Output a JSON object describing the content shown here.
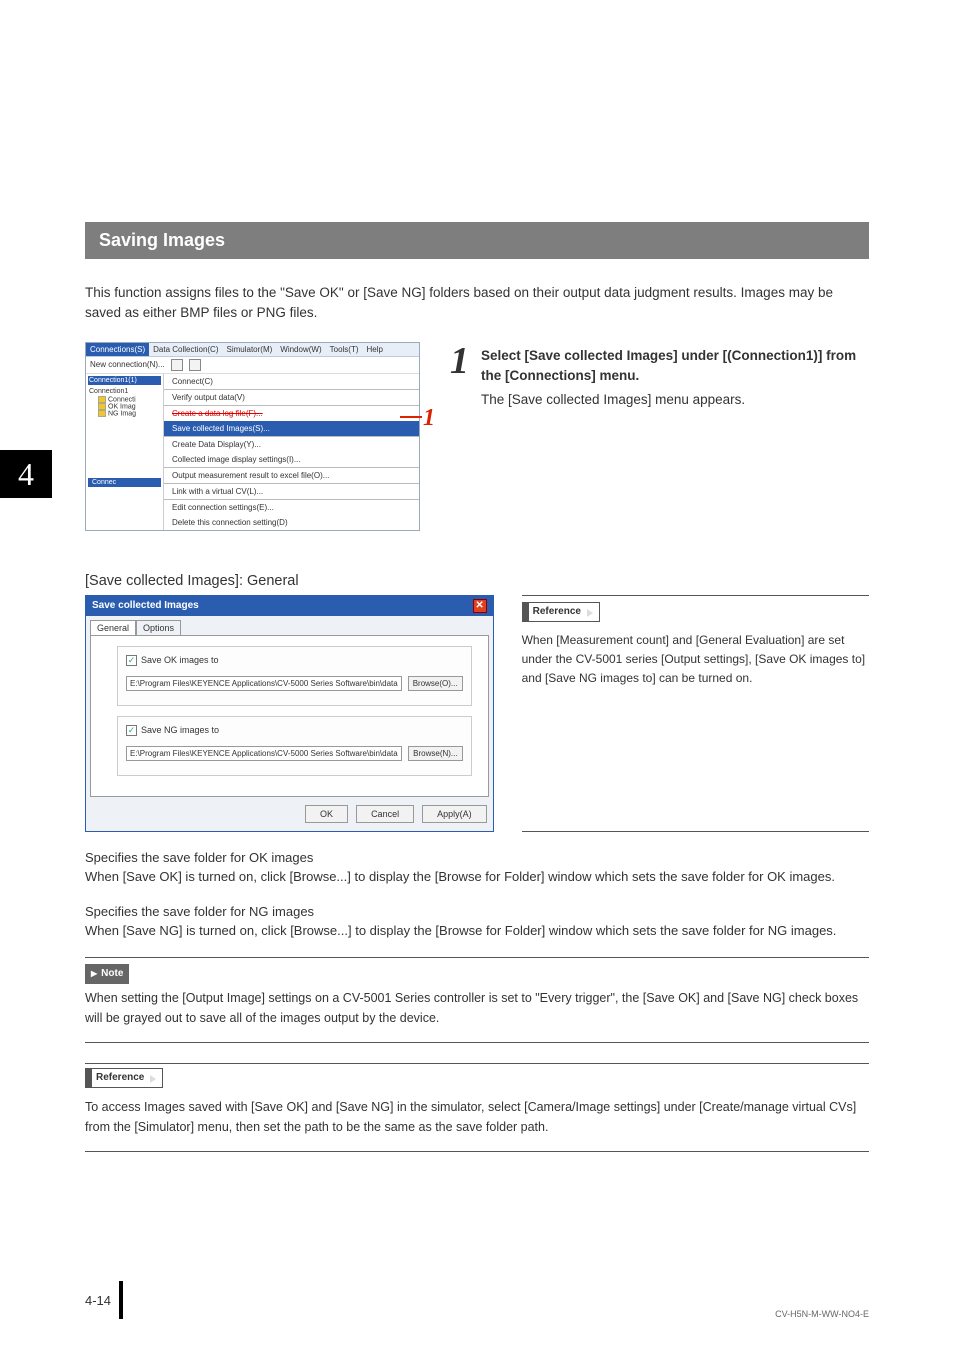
{
  "chapter_number": "4",
  "section_header": "Saving Images",
  "intro": "This function assigns files to the \"Save OK\" or [Save NG] folders based on their output data judgment results. Images may be saved as either BMP files or PNG files.",
  "step1": {
    "num": "1",
    "title": "Select [Save collected Images] under [(Connection1)] from the [Connections] menu.",
    "desc": "The [Save collected Images] menu appears."
  },
  "menu_shot": {
    "menubar": [
      "Connections(S)",
      "Data Collection(C)",
      "Simulator(M)",
      "Window(W)",
      "Tools(T)",
      "Help"
    ],
    "new_conn": "New connection(N)...",
    "conn1": "Connection1(1)",
    "tree_root": "Connection1",
    "tree_items": [
      "Connecti",
      "OK Imag",
      "NG Imag"
    ],
    "status": "Connec",
    "submenu": [
      "Connect(C)",
      "Verify output data(V)",
      "Create a data log file(F)...",
      "Save collected Images(S)...",
      "Create Data Display(Y)...",
      "Collected image display settings(I)...",
      "Output measurement result to excel file(O)...",
      "Link with a virtual CV(L)...",
      "Edit connection settings(E)...",
      "Delete this connection setting(D)"
    ],
    "callout": "1"
  },
  "sub_heading": "[Save collected Images]: General",
  "dialog": {
    "title": "Save collected Images",
    "tabs": [
      "General",
      "Options"
    ],
    "save_ok_label": "Save OK images to",
    "save_ng_label": "Save NG images to",
    "path": "E:\\Program Files\\KEYENCE Applications\\CV-5000 Series Software\\bin\\data",
    "browse_o": "Browse(O)...",
    "browse_n": "Browse(N)...",
    "ok": "OK",
    "cancel": "Cancel",
    "apply": "Apply(A)"
  },
  "ref_label": "Reference",
  "ref1_text": "When [Measurement count] and [General Evaluation] are set under the CV-5001 series [Output settings], [Save OK images to] and [Save NG images to] can be turned on.",
  "ok_spec_title": "Specifies the save folder for OK images",
  "ok_spec_text": "When [Save OK] is turned on, click [Browse...] to display the [Browse for Folder] window which sets the save folder for OK images.",
  "ng_spec_title": "Specifies the save folder for NG images",
  "ng_spec_text": "When [Save NG] is turned on, click [Browse...] to display the [Browse for Folder] window which sets the save folder for NG images.",
  "note_label": "Note",
  "note_text": "When setting the [Output Image] settings on a CV-5001 Series controller is set to \"Every trigger\", the [Save OK] and [Save NG] check boxes will be grayed out to save all of the images output by the device.",
  "ref2_text": "To access Images saved with [Save OK] and [Save NG] in the simulator, select [Camera/Image settings] under [Create/manage virtual CVs] from the [Simulator] menu, then set the path to be the same as the save folder path.",
  "page_number": "4-14",
  "doc_code": "CV-H5N-M-WW-NO4-E"
}
